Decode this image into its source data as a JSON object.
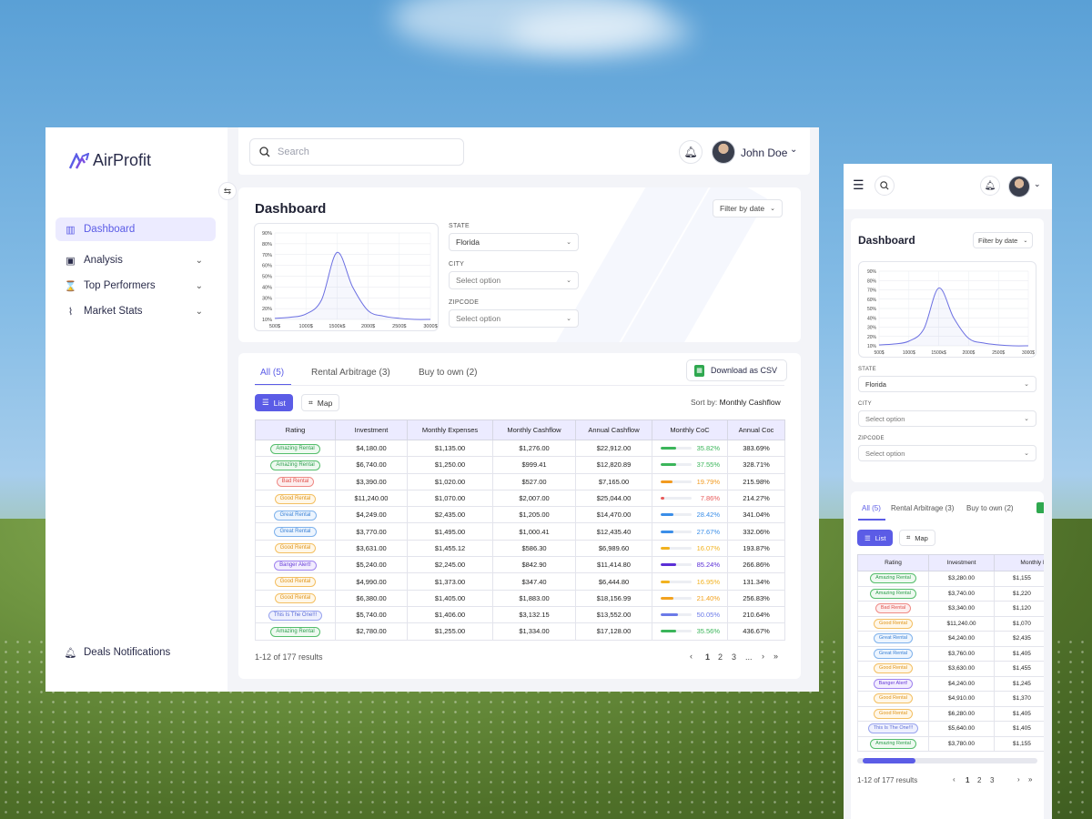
{
  "app": {
    "brand": "AirProfit"
  },
  "sidebar": {
    "items": [
      {
        "label": "Dashboard"
      },
      {
        "label": "Analysis"
      },
      {
        "label": "Top Performers"
      },
      {
        "label": "Market Stats"
      }
    ],
    "bottom": "Deals Notifications"
  },
  "header": {
    "search_placeholder": "Search",
    "user": "John Doe"
  },
  "dashboard": {
    "title": "Dashboard",
    "filter_by_date": "Filter by date",
    "state_label": "STATE",
    "state_value": "Florida",
    "city_label": "CITY",
    "city_placeholder": "Select option",
    "zip_label": "ZIPCODE",
    "zip_placeholder": "Select option"
  },
  "chart_data": {
    "type": "area",
    "title": "",
    "xlabel": "",
    "ylabel": "",
    "x_ticks": [
      "500$",
      "1000$",
      "1500k$",
      "2000$",
      "2500$",
      "3000$"
    ],
    "y_ticks": [
      "10%",
      "20%",
      "30%",
      "40%",
      "50%",
      "60%",
      "70%",
      "80%",
      "90%"
    ],
    "ylim": [
      10,
      90
    ],
    "xlim": [
      500,
      3000
    ],
    "x": [
      500,
      750,
      1000,
      1250,
      1500,
      1750,
      2000,
      2250,
      2500,
      2750,
      3000
    ],
    "values": [
      11,
      12,
      15,
      28,
      72,
      40,
      18,
      13,
      11,
      10,
      10
    ],
    "grid": true,
    "color": "#6b6fe2"
  },
  "tabs": [
    "All (5)",
    "Rental Arbitrage (3)",
    "Buy to own (2)"
  ],
  "download_label": "Download as CSV",
  "view": {
    "list": "List",
    "map": "Map"
  },
  "sort": {
    "label": "Sort by:",
    "value": "Monthly Cashflow"
  },
  "table": {
    "headers": [
      "Rating",
      "Investment",
      "Monthly Expenses",
      "Monthly Cashflow",
      "Annual Cashflow",
      "Monthly CoC",
      "Annual Coc"
    ],
    "rows": [
      {
        "rating": "Amazing Rental",
        "kind": "amazing",
        "inv": "$4,180.00",
        "exp": "$1,135.00",
        "cf": "$1,276.00",
        "acf": "$22,912.00",
        "coc": "35.82%",
        "coc_frac": 0.5,
        "acoc": "383.69%",
        "color": "#3bb55a"
      },
      {
        "rating": "Amazing Rental",
        "kind": "amazing",
        "inv": "$6,740.00",
        "exp": "$1,250.00",
        "cf": "$999.41",
        "acf": "$12,820.89",
        "coc": "37.55%",
        "coc_frac": 0.5,
        "acoc": "328.71%",
        "color": "#3bb55a"
      },
      {
        "rating": "Bad Rental",
        "kind": "bad",
        "inv": "$3,390.00",
        "exp": "$1,020.00",
        "cf": "$527.00",
        "acf": "$7,165.00",
        "coc": "19.79%",
        "coc_frac": 0.38,
        "acoc": "215.98%",
        "color": "#f29a1f"
      },
      {
        "rating": "Good Rental",
        "kind": "good",
        "inv": "$11,240.00",
        "exp": "$1,070.00",
        "cf": "$2,007.00",
        "acf": "$25,044.00",
        "coc": "7.86%",
        "coc_frac": 0.12,
        "acoc": "214.27%",
        "color": "#e85a5a"
      },
      {
        "rating": "Great Rental",
        "kind": "great",
        "inv": "$4,249.00",
        "exp": "$2,435.00",
        "cf": "$1,205.00",
        "acf": "$14,470.00",
        "coc": "28.42%",
        "coc_frac": 0.4,
        "acoc": "341.04%",
        "color": "#3b8ee8"
      },
      {
        "rating": "Great Rental",
        "kind": "great",
        "inv": "$3,770.00",
        "exp": "$1,495.00",
        "cf": "$1,000.41",
        "acf": "$12,435.40",
        "coc": "27.67%",
        "coc_frac": 0.4,
        "acoc": "332.06%",
        "color": "#3b8ee8"
      },
      {
        "rating": "Good Rental",
        "kind": "good",
        "inv": "$3,631.00",
        "exp": "$1,455.12",
        "cf": "$586.30",
        "acf": "$6,989.60",
        "coc": "16.07%",
        "coc_frac": 0.3,
        "acoc": "193.87%",
        "color": "#f2b21f"
      },
      {
        "rating": "Banger Alert!",
        "kind": "banger",
        "inv": "$5,240.00",
        "exp": "$2,245.00",
        "cf": "$842.90",
        "acf": "$11,414.80",
        "coc": "85.24%",
        "coc_frac": 0.5,
        "acoc": "266.86%",
        "color": "#5b2fd6"
      },
      {
        "rating": "Good Rental",
        "kind": "good",
        "inv": "$4,990.00",
        "exp": "$1,373.00",
        "cf": "$347.40",
        "acf": "$6,444.80",
        "coc": "16.95%",
        "coc_frac": 0.3,
        "acoc": "131.34%",
        "color": "#f2b21f"
      },
      {
        "rating": "Good Rental",
        "kind": "good",
        "inv": "$6,380.00",
        "exp": "$1,405.00",
        "cf": "$1,883.00",
        "acf": "$18,156.99",
        "coc": "21.40%",
        "coc_frac": 0.4,
        "acoc": "256.83%",
        "color": "#f2a21f"
      },
      {
        "rating": "This Is The One!!!",
        "kind": "one",
        "inv": "$5,740.00",
        "exp": "$1,406.00",
        "cf": "$3,132.15",
        "acf": "$13,552.00",
        "coc": "50.05%",
        "coc_frac": 0.55,
        "acoc": "210.64%",
        "color": "#6b7ae8"
      },
      {
        "rating": "Amazing Rental",
        "kind": "amazing",
        "inv": "$2,780.00",
        "exp": "$1,255.00",
        "cf": "$1,334.00",
        "acf": "$17,128.00",
        "coc": "35.56%",
        "coc_frac": 0.5,
        "acoc": "436.67%",
        "color": "#3bb55a"
      }
    ]
  },
  "footer": {
    "results": "1-12 of 177 results",
    "pages": [
      "1",
      "2",
      "3",
      "..."
    ]
  },
  "mobile": {
    "tabs": [
      "All (5)",
      "Rental Arbitrage (3)",
      "Buy to own (2)"
    ],
    "headers": [
      "Rating",
      "Investment",
      "Monthly Ex"
    ],
    "rows": [
      {
        "rating": "Amazing Rental",
        "kind": "amazing",
        "inv": "$3,280.00",
        "exp": "$1,155"
      },
      {
        "rating": "Amazing Rental",
        "kind": "amazing",
        "inv": "$3,740.00",
        "exp": "$1,220"
      },
      {
        "rating": "Bad Rental",
        "kind": "bad",
        "inv": "$3,340.00",
        "exp": "$1,120"
      },
      {
        "rating": "Good Rental",
        "kind": "good",
        "inv": "$11,240.00",
        "exp": "$1,070"
      },
      {
        "rating": "Great Rental",
        "kind": "great",
        "inv": "$4,240.00",
        "exp": "$2,435"
      },
      {
        "rating": "Great Rental",
        "kind": "great",
        "inv": "$3,760.00",
        "exp": "$1,405"
      },
      {
        "rating": "Good Rental",
        "kind": "good",
        "inv": "$3,630.00",
        "exp": "$1,455"
      },
      {
        "rating": "Banger Alert!",
        "kind": "banger",
        "inv": "$4,240.00",
        "exp": "$1,245"
      },
      {
        "rating": "Good Rental",
        "kind": "good",
        "inv": "$4,910.00",
        "exp": "$1,370"
      },
      {
        "rating": "Good Rental",
        "kind": "good",
        "inv": "$6,280.00",
        "exp": "$1,405"
      },
      {
        "rating": "This Is The One!!!",
        "kind": "one",
        "inv": "$5,640.00",
        "exp": "$1,405"
      },
      {
        "rating": "Amazing Rental",
        "kind": "amazing",
        "inv": "$3,780.00",
        "exp": "$1,155"
      }
    ]
  }
}
